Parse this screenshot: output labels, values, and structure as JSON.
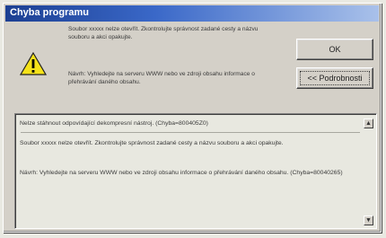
{
  "dialog": {
    "title": "Chyba programu",
    "message": "Soubor xxxxx nelze otevřít. Zkontrolujte správnost zadané cesty a názvu souboru a akci opakujte.",
    "hint": "Návrh: Vyhledejte na serveru WWW nebo ve zdroji obsahu informace o přehrávání daného obsahu.",
    "icon": "warning-icon"
  },
  "buttons": {
    "ok": "OK",
    "details": "<< Podrobnosti"
  },
  "details": {
    "line1": "Nelze stáhnout odpovídající dekompresní nástroj. (Chyba=800405Z0)",
    "line2": "Soubor xxxxx nelze otevřít. Zkontrolujte správnost zadané cesty a názvu souboru a akci opakujte.",
    "line3": "Návrh: Vyhledejte na serveru WWW nebo ve zdroji obsahu informace o přehrávání daného obsahu. (Chyba=80040265)"
  }
}
